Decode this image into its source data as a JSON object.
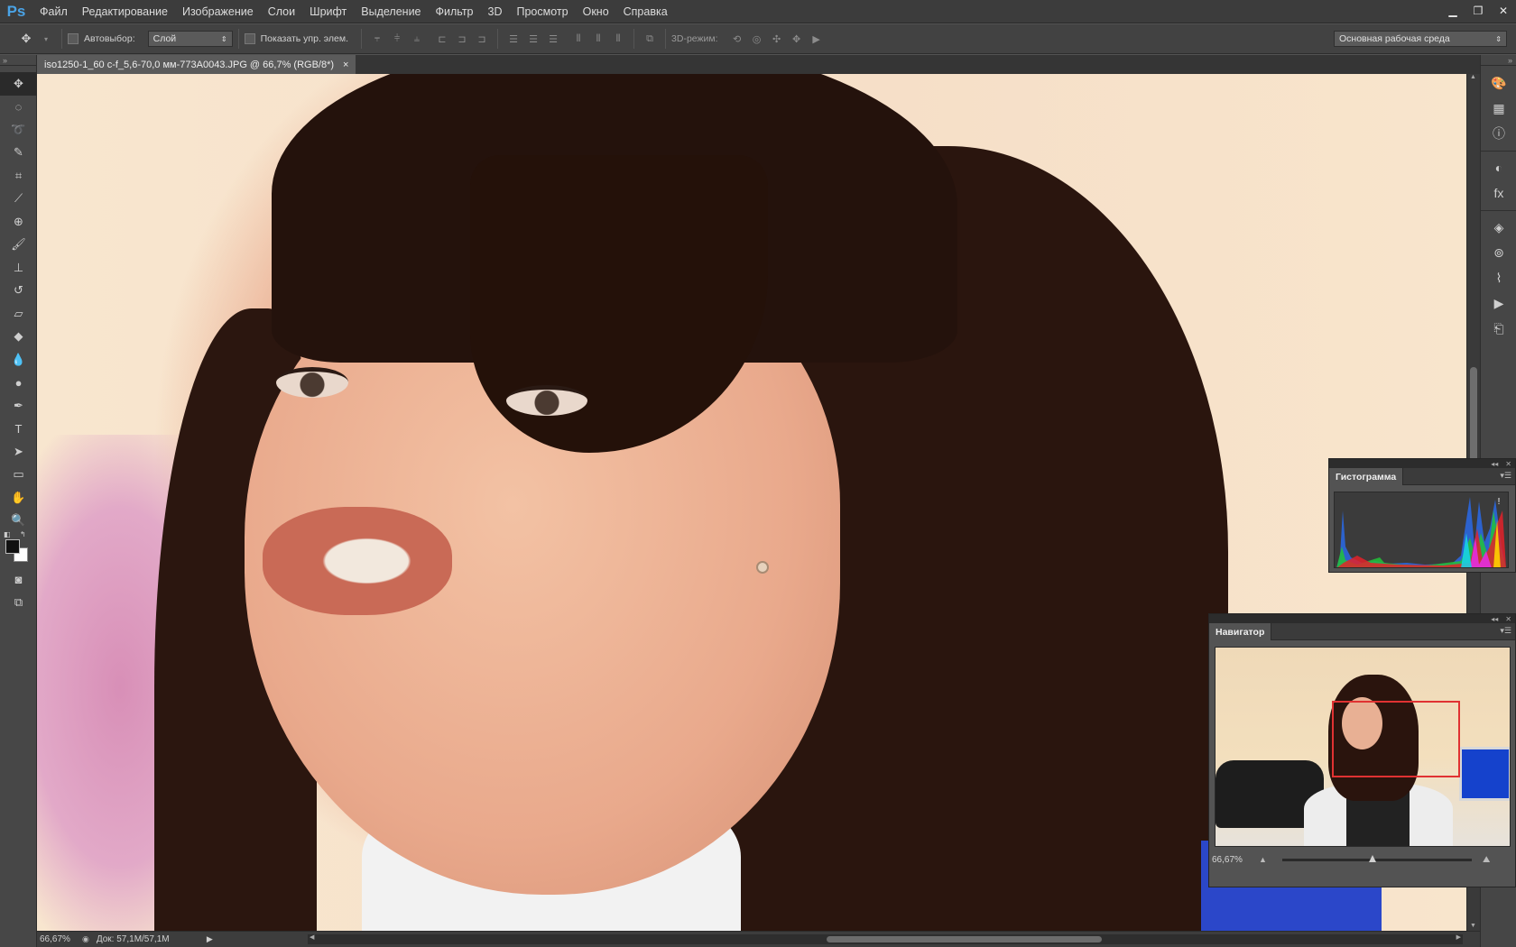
{
  "app": {
    "logo": "Ps"
  },
  "menu": [
    "Файл",
    "Редактирование",
    "Изображение",
    "Слои",
    "Шрифт",
    "Выделение",
    "Фильтр",
    "3D",
    "Просмотр",
    "Окно",
    "Справка"
  ],
  "window_controls": {
    "minimize": "▁",
    "restore": "❐",
    "close": "✕"
  },
  "options": {
    "autoselect_label": "Автовыбор:",
    "autoselect_value": "Слой",
    "show_transform_label": "Показать упр. элем.",
    "mode3d_label": "3D-режим:",
    "workspace_value": "Основная рабочая среда"
  },
  "document": {
    "tab_title": "iso1250-1_60 c-f_5,6-70,0 мм-773A0043.JPG @ 66,7% (RGB/8*)",
    "close": "×"
  },
  "status": {
    "zoom": "66,67%",
    "doc": "Док: 57,1M/57,1M"
  },
  "tools": [
    {
      "name": "move-tool",
      "glyph": "✥"
    },
    {
      "name": "elliptical-marquee-tool",
      "glyph": "◌"
    },
    {
      "name": "lasso-tool",
      "glyph": "➰"
    },
    {
      "name": "quick-selection-tool",
      "glyph": "✎"
    },
    {
      "name": "crop-tool",
      "glyph": "⌗"
    },
    {
      "name": "eyedropper-tool",
      "glyph": "⟋"
    },
    {
      "name": "spot-healing-tool",
      "glyph": "⊕"
    },
    {
      "name": "brush-tool",
      "glyph": "🖌"
    },
    {
      "name": "clone-stamp-tool",
      "glyph": "⊥"
    },
    {
      "name": "history-brush-tool",
      "glyph": "↺"
    },
    {
      "name": "eraser-tool",
      "glyph": "▱"
    },
    {
      "name": "paint-bucket-tool",
      "glyph": "◆"
    },
    {
      "name": "blur-tool",
      "glyph": "💧"
    },
    {
      "name": "dodge-tool",
      "glyph": "●"
    },
    {
      "name": "pen-tool",
      "glyph": "✒"
    },
    {
      "name": "type-tool",
      "glyph": "T"
    },
    {
      "name": "path-selection-tool",
      "glyph": "➤"
    },
    {
      "name": "rectangle-tool",
      "glyph": "▭"
    },
    {
      "name": "hand-tool",
      "glyph": "✋"
    },
    {
      "name": "zoom-tool",
      "glyph": "🔍"
    }
  ],
  "dock_icons": [
    "color-icon",
    "swatches-icon",
    "info-icon",
    "adjustments-icon",
    "styles-icon",
    "layers-icon",
    "channels-icon",
    "paths-icon",
    "actions-icon",
    "history-icon"
  ],
  "histogram_panel": {
    "title": "Гистограмма",
    "warning": "!"
  },
  "navigator_panel": {
    "title": "Навигатор",
    "zoom": "66,67%"
  },
  "panel_controls": {
    "collapse": "◂◂",
    "close": "✕",
    "menu": "▾☰"
  }
}
